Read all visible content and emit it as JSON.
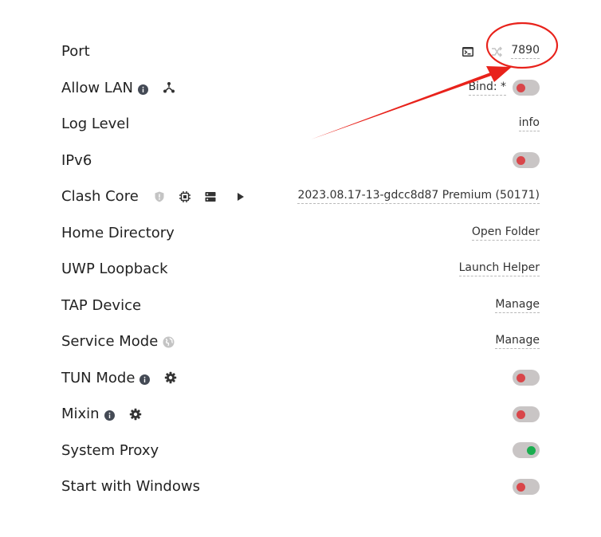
{
  "settings": {
    "port": {
      "label": "Port",
      "value": "7890"
    },
    "allow_lan": {
      "label": "Allow LAN",
      "bind_label": "Bind: *",
      "enabled": false
    },
    "log_level": {
      "label": "Log Level",
      "value": "info"
    },
    "ipv6": {
      "label": "IPv6",
      "enabled": false
    },
    "clash_core": {
      "label": "Clash Core",
      "version": "2023.08.17-13-gdcc8d87 Premium (50171)"
    },
    "home_directory": {
      "label": "Home Directory",
      "action": "Open Folder"
    },
    "uwp_loopback": {
      "label": "UWP Loopback",
      "action": "Launch Helper"
    },
    "tap_device": {
      "label": "TAP Device",
      "action": "Manage"
    },
    "service_mode": {
      "label": "Service Mode",
      "action": "Manage"
    },
    "tun_mode": {
      "label": "TUN Mode",
      "enabled": false
    },
    "mixin": {
      "label": "Mixin",
      "enabled": false
    },
    "system_proxy": {
      "label": "System Proxy",
      "enabled": true
    },
    "start_with_windows": {
      "label": "Start with Windows",
      "enabled": false
    }
  },
  "icons": {
    "info": "info-icon",
    "lan": "network-nodes-icon",
    "terminal": "terminal-icon",
    "random": "shuffle-icon",
    "shield": "shield-icon",
    "chip": "chip-icon",
    "server": "server-icon",
    "play": "play-icon",
    "globe": "globe-icon",
    "gear": "gear-icon"
  },
  "colors": {
    "switch_track": "#c9c5c5",
    "switch_off_knob": "#d9464a",
    "switch_on_knob": "#1aad4f",
    "annotation": "#e8221b"
  }
}
